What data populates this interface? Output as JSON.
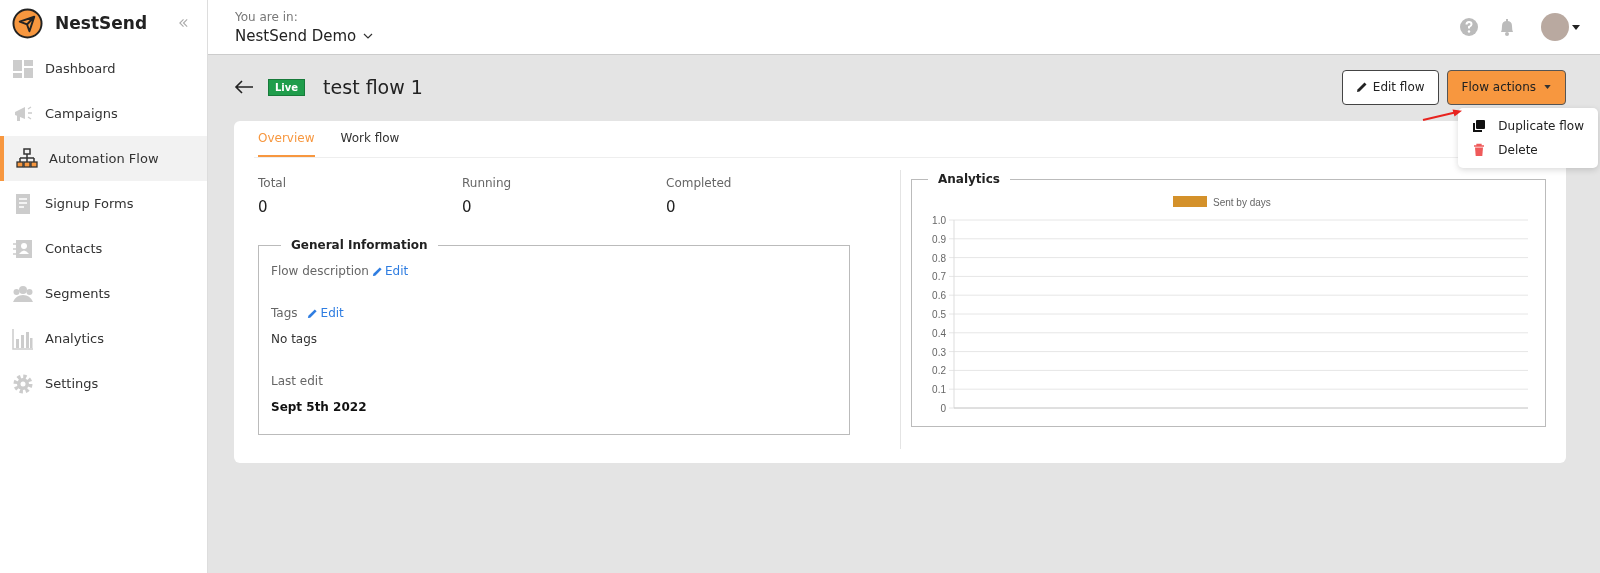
{
  "brand": {
    "name": "NestSend"
  },
  "sidebar": {
    "items": [
      {
        "label": "Dashboard",
        "selected": false
      },
      {
        "label": "Campaigns",
        "selected": false
      },
      {
        "label": "Automation Flow",
        "selected": true
      },
      {
        "label": "Signup Forms",
        "selected": false
      },
      {
        "label": "Contacts",
        "selected": false
      },
      {
        "label": "Segments",
        "selected": false
      },
      {
        "label": "Analytics",
        "selected": false
      },
      {
        "label": "Settings",
        "selected": false
      }
    ]
  },
  "header": {
    "context_label": "You are in:",
    "workspace": "NestSend Demo"
  },
  "page": {
    "status_badge": "Live",
    "title": "test flow 1",
    "edit_button": "Edit flow",
    "actions_button": "Flow actions",
    "actions_menu": [
      {
        "label": "Duplicate flow",
        "kind": "duplicate"
      },
      {
        "label": "Delete",
        "kind": "delete"
      }
    ]
  },
  "tabs": [
    {
      "label": "Overview",
      "selected": true
    },
    {
      "label": "Work flow",
      "selected": false
    }
  ],
  "stats": [
    {
      "label": "Total",
      "value": "0"
    },
    {
      "label": "Running",
      "value": "0"
    },
    {
      "label": "Completed",
      "value": "0"
    }
  ],
  "general_information": {
    "title": "General Information",
    "description_label": "Flow description",
    "description_edit": "Edit",
    "tags_label": "Tags",
    "tags_edit": "Edit",
    "tags_value": "No tags",
    "last_edit_label": "Last edit",
    "last_edit_value": "Sept 5th 2022"
  },
  "analytics": {
    "title": "Analytics",
    "chart_data": {
      "type": "bar",
      "series": [
        {
          "name": "Sent by days",
          "color": "#d4912a"
        }
      ],
      "ylim": [
        0,
        1
      ],
      "grid": true,
      "yticks": [
        0,
        0.1,
        0.2,
        0.3,
        0.4,
        0.5,
        0.6,
        0.7,
        0.8,
        0.9,
        {
          "value": 1,
          "label": "1.0"
        }
      ]
    }
  }
}
